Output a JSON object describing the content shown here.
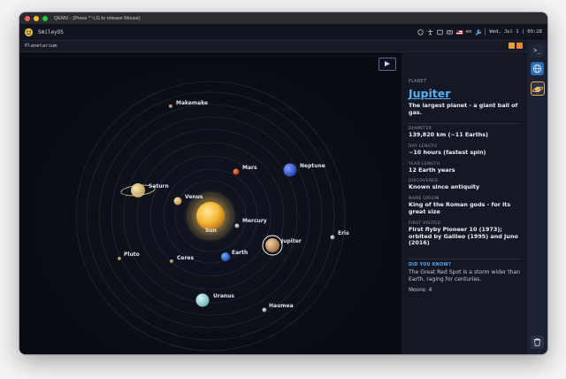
{
  "window": {
    "title": "QEMU - (Press ^⌥G to release Mouse)"
  },
  "os": {
    "name": "SmileyOS",
    "lang": "en",
    "datetime": "Wed, Jul 1 | 09:28"
  },
  "app": {
    "title": "Planetarium"
  },
  "planets": [
    {
      "name": "Sun"
    },
    {
      "name": "Makemake"
    },
    {
      "name": "Mars"
    },
    {
      "name": "Neptune"
    },
    {
      "name": "Saturn"
    },
    {
      "name": "Venus"
    },
    {
      "name": "Mercury"
    },
    {
      "name": "Jupiter"
    },
    {
      "name": "Eris"
    },
    {
      "name": "Pluto"
    },
    {
      "name": "Ceres"
    },
    {
      "name": "Earth"
    },
    {
      "name": "Uranus"
    },
    {
      "name": "Haumea"
    }
  ],
  "info": {
    "kicker": "PLANET",
    "name": "Jupiter",
    "desc": "The largest planet - a giant ball of gas.",
    "facts": [
      {
        "label": "DIAMETER",
        "value": "139,820 km (~11 Earths)"
      },
      {
        "label": "DAY LENGTH",
        "value": "~10 hours (fastest spin)"
      },
      {
        "label": "YEAR LENGTH",
        "value": "12 Earth years"
      },
      {
        "label": "DISCOVERED",
        "value": "Known since antiquity"
      },
      {
        "label": "NAME ORIGIN",
        "value": "King of the Roman gods - for its great size"
      },
      {
        "label": "FIRST VISITED",
        "value": "First flyby Pioneer 10 (1973); orbited by Galileo (1995) and Juno (2016)"
      }
    ],
    "did_you_know_title": "DID YOU KNOW?",
    "did_you_know": "The Great Red Spot is a storm wider than Earth, raging for centuries.",
    "moons": "Moons: 4"
  },
  "dock": {
    "terminal_glyph": ">_"
  },
  "colors": {
    "accent": "#5ab0f5",
    "background": "#0a0d16",
    "panel": "#131824",
    "highlight": "#e5a64a"
  }
}
